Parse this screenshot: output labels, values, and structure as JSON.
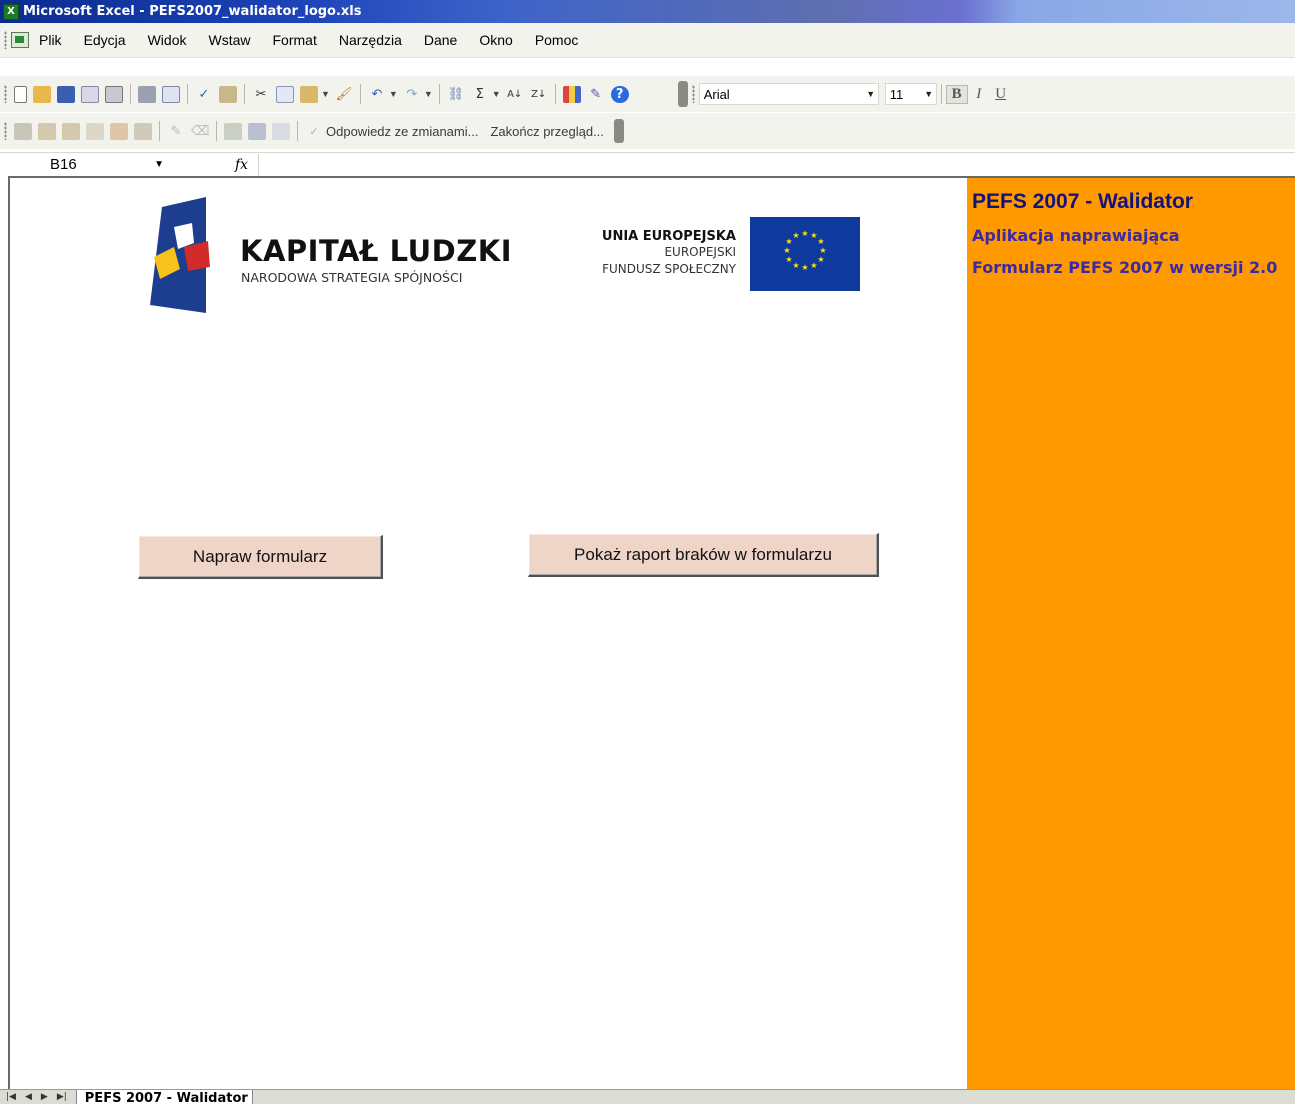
{
  "window": {
    "title": "Microsoft Excel - PEFS2007_walidator_logo.xls",
    "app_icon": "excel-icon"
  },
  "menu": {
    "items": [
      "Plik",
      "Edycja",
      "Widok",
      "Wstaw",
      "Format",
      "Narzędzia",
      "Dane",
      "Okno",
      "Pomoc"
    ]
  },
  "formatting": {
    "font_name": "Arial",
    "font_size": "11",
    "bold_label": "B",
    "italic_label": "I",
    "underline_label": "U"
  },
  "reviewing": {
    "reply_label": "Odpowiedz ze zmianami...",
    "end_review_label": "Zakończ przegląd..."
  },
  "formula_bar": {
    "name_box": "B16",
    "fx_label": "fx",
    "formula": ""
  },
  "panel": {
    "title": "PEFS 2007 - Walidator",
    "line1": "Aplikacja naprawiająca",
    "line2": "Formularz PEFS 2007 w wersji 2.0",
    "background": "#ff9900"
  },
  "logos": {
    "kl_title": "KAPITAŁ LUDZKI",
    "kl_subtitle": "NARODOWA STRATEGIA SPÓJNOŚCI",
    "ue_title": "UNIA EUROPEJSKA",
    "ue_line1": "EUROPEJSKI",
    "ue_line2": "FUNDUSZ SPOŁECZNY"
  },
  "buttons": {
    "fix_form": "Napraw formularz",
    "show_report": "Pokaż raport braków w formularzu"
  },
  "sheet_tabs": {
    "active": "PEFS 2007 - Walidator"
  }
}
